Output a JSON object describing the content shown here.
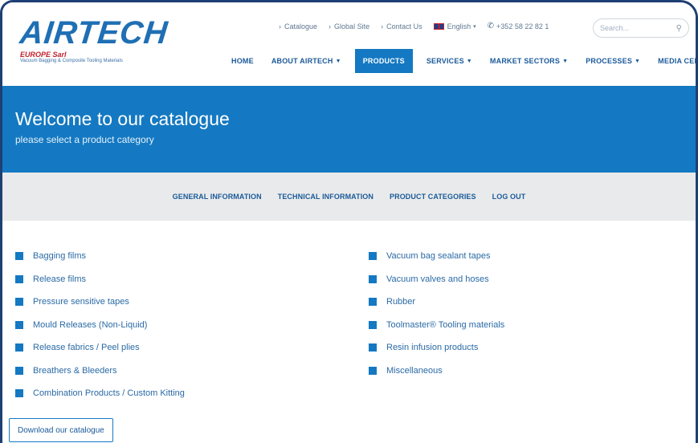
{
  "brand": {
    "logo": "AIRTECH",
    "sub1": "EUROPE Sarl",
    "sub2": "Vacuum Bagging & Composite Tooling Materials"
  },
  "toplinks": {
    "catalogue": "Catalogue",
    "global_site": "Global Site",
    "contact": "Contact Us",
    "language": "English",
    "phone": "+352 58 22 82 1"
  },
  "search": {
    "placeholder": "Search..."
  },
  "nav": {
    "home": "HOME",
    "about": "ABOUT AIRTECH",
    "products": "PRODUCTS",
    "services": "SERVICES",
    "market": "MARKET SECTORS",
    "processes": "PROCESSES",
    "media": "MEDIA CENTER"
  },
  "hero": {
    "title": "Welcome to our catalogue",
    "subtitle": "please select a product category"
  },
  "subnav": {
    "general": "GENERAL INFORMATION",
    "technical": "TECHNICAL INFORMATION",
    "categories": "PRODUCT CATEGORIES",
    "logout": "LOG OUT"
  },
  "categories_left": [
    "Bagging films",
    "Release films",
    "Pressure sensitive tapes",
    "Mould Releases (Non-Liquid)",
    "Release fabrics / Peel plies",
    "Breathers & Bleeders",
    "Combination Products / Custom Kitting"
  ],
  "categories_right": [
    "Vacuum bag sealant tapes",
    "Vacuum valves and hoses",
    "Rubber",
    "Toolmaster® Tooling materials",
    "Resin infusion products",
    "Miscellaneous"
  ],
  "download_label": "Download our catalogue",
  "colors": {
    "accent": "#1479c2",
    "brand_red": "#c0202a",
    "subnav_bg": "#e9eaeb",
    "frame": "#1e3f73"
  }
}
